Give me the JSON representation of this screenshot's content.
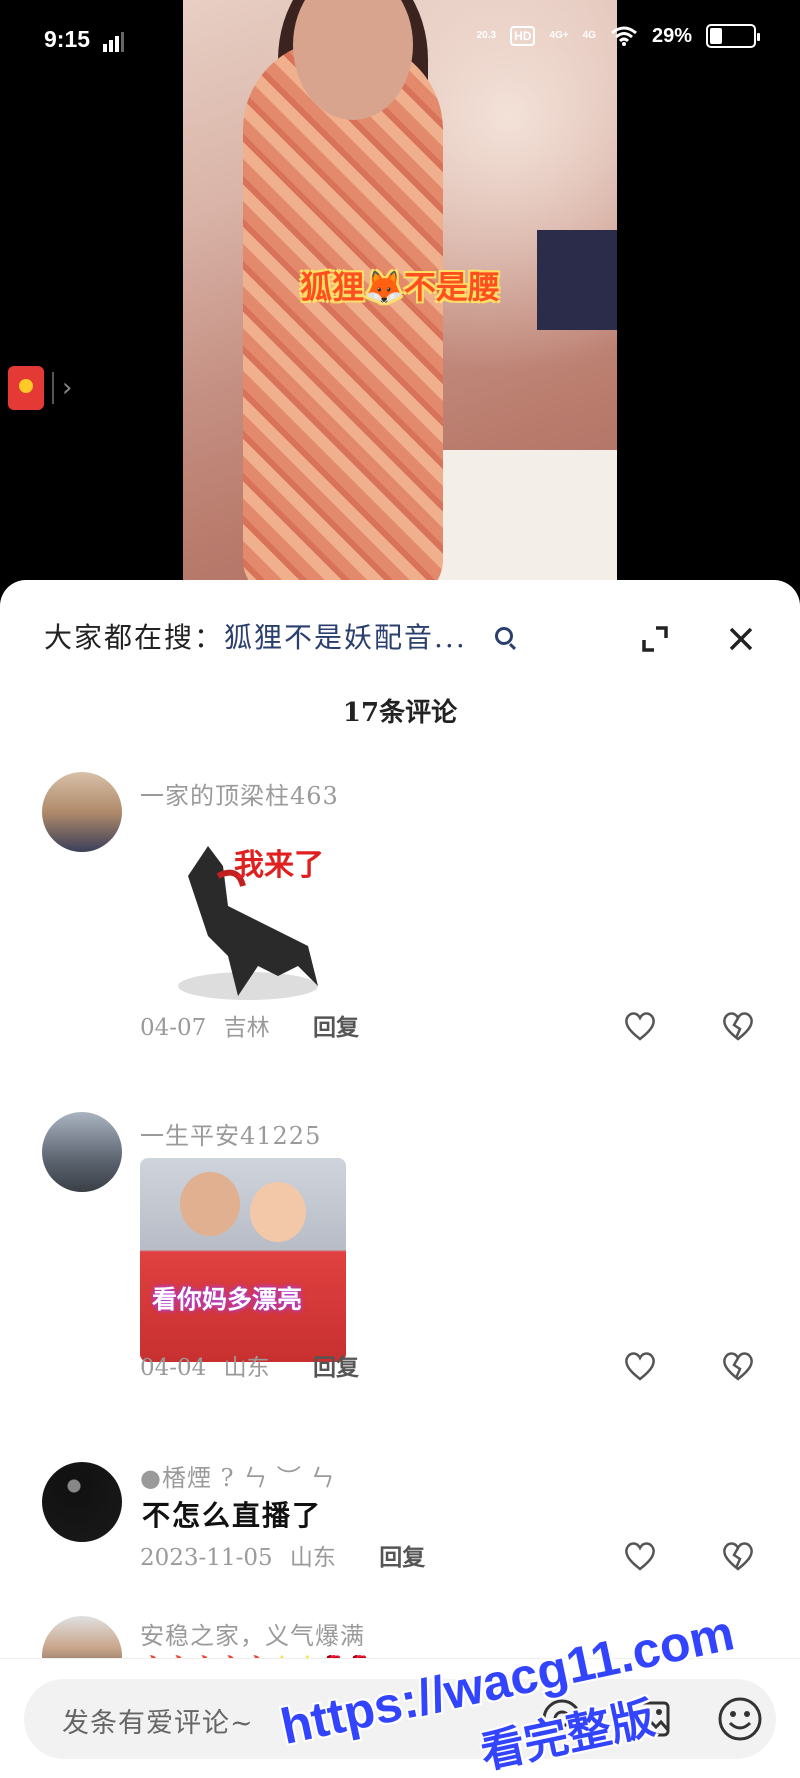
{
  "status_bar": {
    "time": "9:15",
    "speed": "20.3",
    "net_badge": "HD",
    "sim1": "4G+",
    "sim2": "4G",
    "battery": "29%",
    "battery_level": 0.29
  },
  "video": {
    "caption": "狐狸🦊不是腰"
  },
  "sheet": {
    "search_prefix": "大家都在搜：",
    "search_term": "狐狸不是妖配音...",
    "comment_count": "17条评论"
  },
  "comments": [
    {
      "user": "一家的顶梁柱463",
      "sticker_text": "我来了",
      "date": "04-07",
      "location": "吉林",
      "reply": "回复"
    },
    {
      "user": "一生平安41225",
      "image_text": "看你妈多漂亮",
      "date": "04-04",
      "location": "山东",
      "reply": "回复"
    },
    {
      "user": "●楿煙 ? ㄣ ︶ ㄣ",
      "text": "不怎么直播了",
      "date": "2023-11-05",
      "location": "山东",
      "reply": "回复"
    },
    {
      "user": "安稳之家，义气爆满",
      "emojis": "🔥🔥🔥🔥🔥🌟🌟🌹🌹"
    }
  ],
  "input_bar": {
    "placeholder": "发条有爱评论~"
  },
  "watermark": {
    "url": "https://wacg11.com",
    "label": "看完整版"
  }
}
